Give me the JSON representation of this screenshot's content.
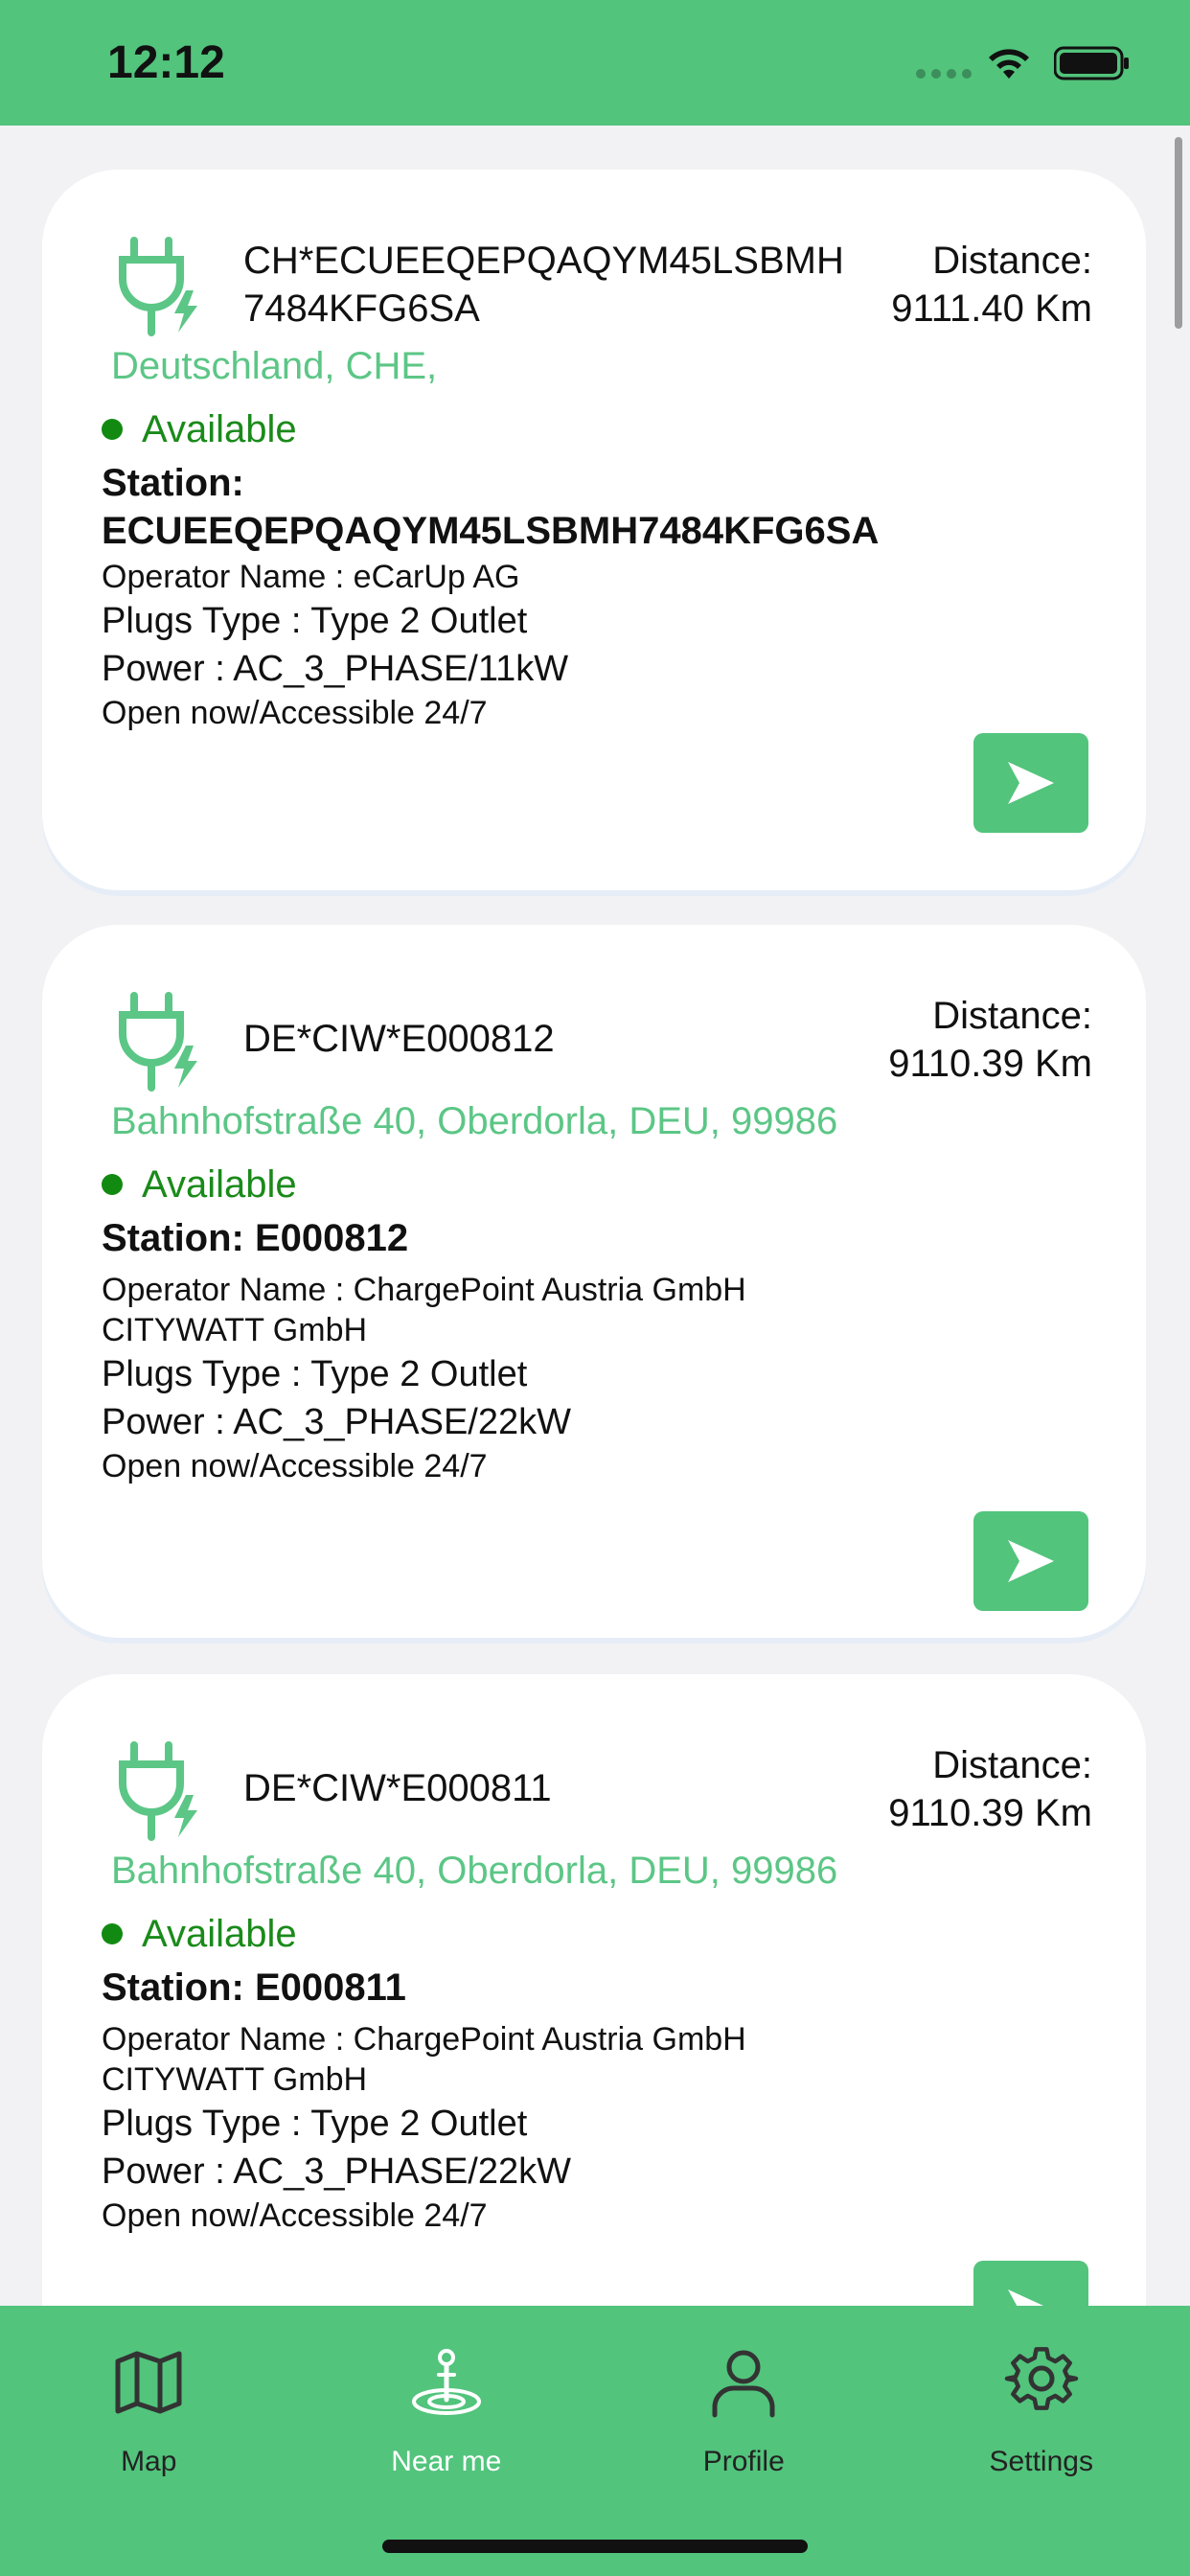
{
  "status": {
    "time": "12:12"
  },
  "stations": [
    {
      "id_line1": "CH*ECUEEQEPQAQYM45LSBMH",
      "id_line2": "7484KFG6SA",
      "distance_label": "Distance:",
      "distance_value": "9111.40 Km",
      "address": "Deutschland,  CHE,",
      "availability": "Available",
      "station_line1": "Station:",
      "station_line2": "ECUEEQEPQAQYM45LSBMH7484KFG6SA",
      "operator_line1": "Operator Name : eCarUp AG",
      "operator_line2": "",
      "plugs": "Plugs Type : Type 2 Outlet",
      "power": "Power : AC_3_PHASE/11kW",
      "open": "Open now/Accessible 24/7"
    },
    {
      "id_line1": "DE*CIW*E000812",
      "id_line2": "",
      "distance_label": "Distance:",
      "distance_value": "9110.39 Km",
      "address": "Bahnhofstraße 40, Oberdorla, DEU, 99986",
      "availability": "Available",
      "station_line1": "Station: E000812",
      "station_line2": "",
      "operator_line1": "Operator Name : ChargePoint Austria GmbH",
      "operator_line2": "CITYWATT GmbH",
      "plugs": "Plugs Type : Type 2 Outlet",
      "power": "Power : AC_3_PHASE/22kW",
      "open": "Open now/Accessible 24/7"
    },
    {
      "id_line1": "DE*CIW*E000811",
      "id_line2": "",
      "distance_label": "Distance:",
      "distance_value": "9110.39 Km",
      "address": "Bahnhofstraße 40, Oberdorla, DEU, 99986",
      "availability": "Available",
      "station_line1": "Station: E000811",
      "station_line2": "",
      "operator_line1": "Operator Name : ChargePoint Austria GmbH",
      "operator_line2": "CITYWATT GmbH",
      "plugs": "Plugs Type : Type 2 Outlet",
      "power": "Power : AC_3_PHASE/22kW",
      "open": "Open now/Accessible 24/7"
    }
  ],
  "tabs": [
    {
      "label": "Map",
      "icon": "map-icon"
    },
    {
      "label": "Near me",
      "icon": "near-me-icon"
    },
    {
      "label": "Profile",
      "icon": "profile-icon"
    },
    {
      "label": "Settings",
      "icon": "gear-icon"
    }
  ],
  "colors": {
    "brand_green": "#52c47c",
    "available_green": "#128a12",
    "address_green": "#5cc686"
  }
}
